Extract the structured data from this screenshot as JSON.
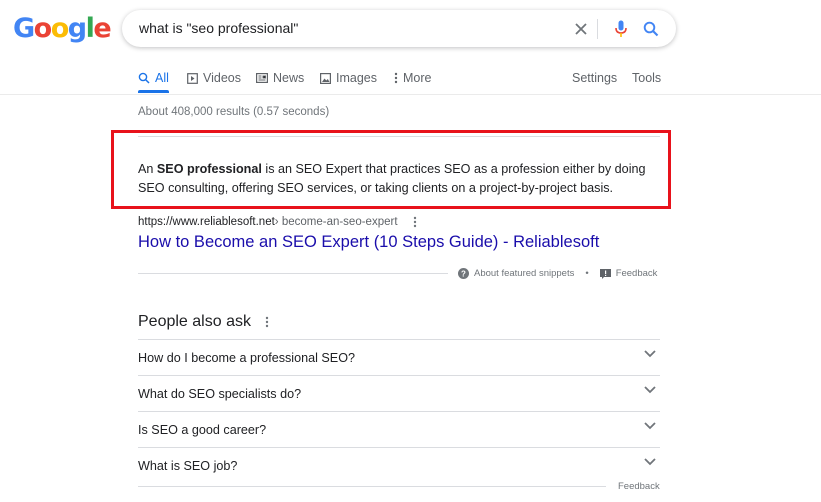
{
  "logo": {
    "letters": [
      "G",
      "o",
      "o",
      "g",
      "l",
      "e"
    ],
    "colors": [
      "#4285f4",
      "#ea4335",
      "#fbbc05",
      "#4285f4",
      "#34a853",
      "#ea4335"
    ]
  },
  "search": {
    "query": "what is \"seo professional\"",
    "icons": [
      "clear-icon",
      "microphone-icon",
      "search-icon"
    ]
  },
  "tabs": {
    "all": "All",
    "videos": "Videos",
    "news": "News",
    "images": "Images",
    "more": "More",
    "settings": "Settings",
    "tools": "Tools"
  },
  "stats": "About 408,000 results (0.57 seconds)",
  "featured_snippet": {
    "text_pre": "An ",
    "text_bold": "SEO professional",
    "text_post": " is an SEO Expert that practices SEO as a profession either by doing SEO consulting, offering SEO services, or taking clients on a project-by-project basis.",
    "cite_domain": "https://www.reliablesoft.net",
    "cite_path": " › become-an-seo-expert",
    "title": "How to Become an SEO Expert (10 Steps Guide) - Reliablesoft",
    "about_label": "About featured snippets",
    "feedback_label": "Feedback"
  },
  "people_also_ask": {
    "title": "People also ask",
    "questions": [
      "How do I become a professional SEO?",
      "What do SEO specialists do?",
      "Is SEO a good career?",
      "What is SEO job?"
    ],
    "feedback_label": "Feedback"
  },
  "colors": {
    "accent": "#1a73e8",
    "link": "#1a0dab",
    "highlight": "#e8121b"
  }
}
